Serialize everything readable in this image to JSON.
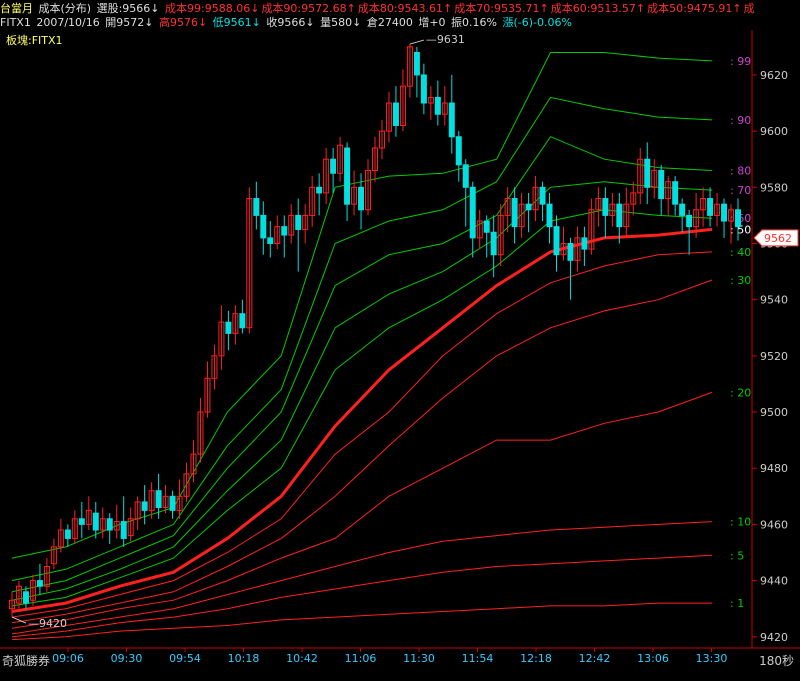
{
  "header": {
    "title": "台當月",
    "indicator": "成本(分布)",
    "selected": "選股:9566↓",
    "cost_labels": [
      {
        "text": "成本99:9588.06↓",
        "color": "#ff3030"
      },
      {
        "text": "成本90:9572.68↑",
        "color": "#ff3030"
      },
      {
        "text": "成本80:9543.61↑",
        "color": "#ff3030"
      },
      {
        "text": "成本70:9535.71↑",
        "color": "#ff3030"
      },
      {
        "text": "成本60:9513.57↑",
        "color": "#ff3030"
      },
      {
        "text": "成本50:9475.91↑",
        "color": "#ff3030"
      },
      {
        "text": "成",
        "color": "#ff3030"
      }
    ]
  },
  "quote": {
    "symbol": "FITX1",
    "date": "2007/10/16",
    "open": "開9572↓",
    "high": "高9576↓",
    "low": "低9561↓",
    "close": "收9566↓",
    "volume": "量580↓",
    "oi": "倉27400",
    "oi_change": "增+0",
    "amplitude": "振0.16%",
    "change": "漲(-6)-0.06%"
  },
  "board": "板塊:FITX1",
  "footer": {
    "broker": "奇狐勝券",
    "period": "180秒"
  },
  "colors": {
    "up": "#ff2020",
    "down": "#00e0e0",
    "green": "#00e000",
    "bg": "#000000",
    "axis": "#cc0000"
  },
  "chart_data": {
    "type": "candlestick",
    "y_ticks": [
      9420,
      9440,
      9460,
      9480,
      9500,
      9520,
      9540,
      9560,
      9580,
      9600,
      9620
    ],
    "x_ticks": [
      "09:06",
      "09:30",
      "09:54",
      "10:18",
      "10:42",
      "11:06",
      "11:30",
      "11:54",
      "12:18",
      "12:42",
      "13:06",
      "13:30"
    ],
    "ylim": [
      9416,
      9636
    ],
    "high_label": "9631",
    "low_label": "9420",
    "last_price": "9562",
    "candles": [
      [
        9430,
        9433,
        9427,
        9436
      ],
      [
        9432,
        9438,
        9430,
        9440
      ],
      [
        9436,
        9432,
        9430,
        9438
      ],
      [
        9433,
        9440,
        9431,
        9442
      ],
      [
        9440,
        9438,
        9435,
        9446
      ],
      [
        9438,
        9445,
        9436,
        9448
      ],
      [
        9446,
        9452,
        9444,
        9455
      ],
      [
        9452,
        9458,
        9450,
        9462
      ],
      [
        9458,
        9455,
        9452,
        9460
      ],
      [
        9455,
        9462,
        9453,
        9465
      ],
      [
        9462,
        9460,
        9455,
        9468
      ],
      [
        9460,
        9465,
        9458,
        9470
      ],
      [
        9464,
        9458,
        9455,
        9468
      ],
      [
        9458,
        9462,
        9455,
        9466
      ],
      [
        9462,
        9458,
        9453,
        9464
      ],
      [
        9458,
        9461,
        9455,
        9467
      ],
      [
        9461,
        9455,
        9452,
        9470
      ],
      [
        9456,
        9462,
        9454,
        9466
      ],
      [
        9462,
        9468,
        9458,
        9470
      ],
      [
        9468,
        9465,
        9460,
        9474
      ],
      [
        9465,
        9472,
        9462,
        9475
      ],
      [
        9472,
        9466,
        9462,
        9478
      ],
      [
        9466,
        9470,
        9464,
        9474
      ],
      [
        9470,
        9465,
        9462,
        9472
      ],
      [
        9465,
        9470,
        9462,
        9476
      ],
      [
        9470,
        9478,
        9468,
        9482
      ],
      [
        9478,
        9485,
        9475,
        9490
      ],
      [
        9485,
        9500,
        9482,
        9505
      ],
      [
        9500,
        9512,
        9498,
        9518
      ],
      [
        9512,
        9520,
        9508,
        9524
      ],
      [
        9520,
        9532,
        9515,
        9538
      ],
      [
        9532,
        9528,
        9522,
        9536
      ],
      [
        9528,
        9535,
        9524,
        9538
      ],
      [
        9535,
        9530,
        9528,
        9540
      ],
      [
        9530,
        9576,
        9528,
        9580
      ],
      [
        9576,
        9570,
        9565,
        9582
      ],
      [
        9570,
        9562,
        9556,
        9575
      ],
      [
        9562,
        9560,
        9555,
        9568
      ],
      [
        9560,
        9566,
        9558,
        9570
      ],
      [
        9566,
        9563,
        9555,
        9570
      ],
      [
        9563,
        9570,
        9560,
        9574
      ],
      [
        9570,
        9565,
        9550,
        9576
      ],
      [
        9565,
        9570,
        9560,
        9574
      ],
      [
        9570,
        9580,
        9566,
        9584
      ],
      [
        9580,
        9578,
        9570,
        9585
      ],
      [
        9578,
        9590,
        9574,
        9594
      ],
      [
        9590,
        9585,
        9578,
        9594
      ],
      [
        9585,
        9595,
        9582,
        9598
      ],
      [
        9594,
        9574,
        9568,
        9596
      ],
      [
        9574,
        9580,
        9570,
        9586
      ],
      [
        9580,
        9572,
        9565,
        9585
      ],
      [
        9572,
        9586,
        9570,
        9590
      ],
      [
        9586,
        9594,
        9582,
        9598
      ],
      [
        9594,
        9600,
        9590,
        9604
      ],
      [
        9600,
        9610,
        9596,
        9614
      ],
      [
        9610,
        9602,
        9598,
        9616
      ],
      [
        9602,
        9616,
        9600,
        9622
      ],
      [
        9616,
        9630,
        9612,
        9631
      ],
      [
        9628,
        9620,
        9612,
        9630
      ],
      [
        9620,
        9610,
        9606,
        9624
      ],
      [
        9610,
        9612,
        9604,
        9616
      ],
      [
        9612,
        9606,
        9602,
        9618
      ],
      [
        9606,
        9610,
        9602,
        9616
      ],
      [
        9610,
        9598,
        9592,
        9620
      ],
      [
        9598,
        9588,
        9582,
        9600
      ],
      [
        9588,
        9580,
        9566,
        9590
      ],
      [
        9580,
        9562,
        9555,
        9582
      ],
      [
        9562,
        9568,
        9558,
        9572
      ],
      [
        9568,
        9564,
        9555,
        9570
      ],
      [
        9564,
        9556,
        9548,
        9570
      ],
      [
        9556,
        9570,
        9552,
        9574
      ],
      [
        9570,
        9576,
        9564,
        9580
      ],
      [
        9576,
        9566,
        9560,
        9580
      ],
      [
        9566,
        9574,
        9562,
        9578
      ],
      [
        9574,
        9572,
        9564,
        9578
      ],
      [
        9572,
        9580,
        9568,
        9584
      ],
      [
        9580,
        9574,
        9568,
        9582
      ],
      [
        9574,
        9566,
        9560,
        9578
      ],
      [
        9566,
        9556,
        9550,
        9570
      ],
      [
        9556,
        9560,
        9554,
        9566
      ],
      [
        9560,
        9554,
        9540,
        9562
      ],
      [
        9554,
        9562,
        9550,
        9566
      ],
      [
        9562,
        9558,
        9552,
        9566
      ],
      [
        9558,
        9572,
        9556,
        9576
      ],
      [
        9572,
        9576,
        9566,
        9580
      ],
      [
        9576,
        9570,
        9562,
        9580
      ],
      [
        9570,
        9574,
        9566,
        9578
      ],
      [
        9574,
        9566,
        9560,
        9578
      ],
      [
        9566,
        9574,
        9562,
        9580
      ],
      [
        9574,
        9578,
        9570,
        9582
      ],
      [
        9578,
        9590,
        9574,
        9594
      ],
      [
        9590,
        9580,
        9574,
        9596
      ],
      [
        9580,
        9586,
        9576,
        9590
      ],
      [
        9586,
        9576,
        9570,
        9588
      ],
      [
        9576,
        9582,
        9570,
        9584
      ],
      [
        9582,
        9574,
        9570,
        9584
      ],
      [
        9574,
        9570,
        9564,
        9576
      ],
      [
        9570,
        9566,
        9556,
        9572
      ],
      [
        9566,
        9572,
        9562,
        9578
      ],
      [
        9572,
        9576,
        9566,
        9580
      ],
      [
        9576,
        9570,
        9566,
        9580
      ],
      [
        9570,
        9574,
        9566,
        9578
      ],
      [
        9574,
        9568,
        9562,
        9576
      ],
      [
        9568,
        9572,
        9560,
        9574
      ],
      [
        9572,
        9566,
        9561,
        9576
      ]
    ],
    "cost_lines": [
      {
        "label": "99",
        "color": "#cc44cc",
        "line": "#00cc00",
        "points": [
          [
            9448,
            9452
          ],
          [
            9460,
            9466
          ],
          [
            9500,
            9520
          ],
          [
            9580,
            9584
          ],
          [
            9585,
            9590
          ],
          [
            9628,
            9628
          ],
          [
            9626,
            9625
          ]
        ]
      },
      {
        "label": "90",
        "color": "#cc44cc",
        "line": "#00cc00",
        "points": [
          [
            9440,
            9444
          ],
          [
            9452,
            9460
          ],
          [
            9488,
            9508
          ],
          [
            9560,
            9568
          ],
          [
            9572,
            9582
          ],
          [
            9612,
            9608
          ],
          [
            9605,
            9604
          ]
        ]
      },
      {
        "label": "80",
        "color": "#cc44cc",
        "line": "#00cc00",
        "points": [
          [
            9436,
            9440
          ],
          [
            9448,
            9456
          ],
          [
            9480,
            9500
          ],
          [
            9545,
            9556
          ],
          [
            9560,
            9570
          ],
          [
            9598,
            9590
          ],
          [
            9587,
            9586
          ]
        ]
      },
      {
        "label": "70",
        "color": "#cc44cc",
        "line": "#00cc00",
        "points": [
          [
            9433,
            9437
          ],
          [
            9444,
            9452
          ],
          [
            9472,
            9490
          ],
          [
            9530,
            9542
          ],
          [
            9550,
            9562
          ],
          [
            9580,
            9582
          ],
          [
            9580,
            9579
          ]
        ]
      },
      {
        "label": "60",
        "color": "#cc44cc",
        "line": "#00cc00",
        "points": [
          [
            9431,
            9434
          ],
          [
            9441,
            9448
          ],
          [
            9465,
            9480
          ],
          [
            9515,
            9530
          ],
          [
            9540,
            9552
          ],
          [
            9568,
            9572
          ],
          [
            9570,
            9569
          ]
        ]
      },
      {
        "label": "50",
        "color": "#ffffff",
        "line": "#ff2020",
        "points": [
          [
            9429,
            9432
          ],
          [
            9438,
            9443
          ],
          [
            9455,
            9470
          ],
          [
            9495,
            9515
          ],
          [
            9530,
            9545
          ],
          [
            9557,
            9562
          ],
          [
            9563,
            9565
          ]
        ]
      },
      {
        "label": "40",
        "color": "#00cc00",
        "line": "#ff2020",
        "points": [
          [
            9427,
            9430
          ],
          [
            9435,
            9440
          ],
          [
            9450,
            9462
          ],
          [
            9485,
            9500
          ],
          [
            9520,
            9535
          ],
          [
            9546,
            9552
          ],
          [
            9556,
            9557
          ]
        ]
      },
      {
        "label": "30",
        "color": "#00cc00",
        "line": "#ff2020",
        "points": [
          [
            9425,
            9428
          ],
          [
            9432,
            9436
          ],
          [
            9445,
            9455
          ],
          [
            9470,
            9488
          ],
          [
            9505,
            9520
          ],
          [
            9530,
            9536
          ],
          [
            9540,
            9547
          ]
        ]
      },
      {
        "label": "20",
        "color": "#00cc00",
        "line": "#ff2020",
        "points": [
          [
            9423,
            9426
          ],
          [
            9430,
            9433
          ],
          [
            9440,
            9448
          ],
          [
            9455,
            9470
          ],
          [
            9480,
            9490
          ],
          [
            9490,
            9496
          ],
          [
            9500,
            9507
          ]
        ]
      },
      {
        "label": "10",
        "color": "#00cc00",
        "line": "#ff2020",
        "points": [
          [
            9421,
            9424
          ],
          [
            9427,
            9430
          ],
          [
            9435,
            9440
          ],
          [
            9445,
            9450
          ],
          [
            9454,
            9456
          ],
          [
            9458,
            9459
          ],
          [
            9460,
            9461
          ]
        ]
      },
      {
        "label": "5",
        "color": "#00cc00",
        "line": "#ff2020",
        "points": [
          [
            9420,
            9422
          ],
          [
            9425,
            9427
          ],
          [
            9430,
            9434
          ],
          [
            9437,
            9440
          ],
          [
            9443,
            9445
          ],
          [
            9446,
            9447
          ],
          [
            9448,
            9449
          ]
        ]
      },
      {
        "label": "1",
        "color": "#00cc00",
        "line": "#ff2020",
        "points": [
          [
            9419,
            9420
          ],
          [
            9422,
            9423
          ],
          [
            9424,
            9426
          ],
          [
            9427,
            9428
          ],
          [
            9429,
            9430
          ],
          [
            9431,
            9431
          ],
          [
            9432,
            9432
          ]
        ]
      }
    ]
  }
}
